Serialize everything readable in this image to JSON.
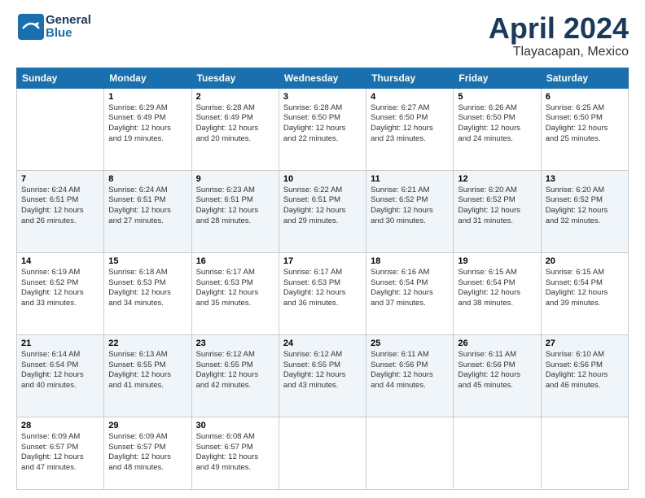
{
  "header": {
    "logo_line1": "General",
    "logo_line2": "Blue",
    "month": "April 2024",
    "location": "Tlayacapan, Mexico"
  },
  "columns": [
    "Sunday",
    "Monday",
    "Tuesday",
    "Wednesday",
    "Thursday",
    "Friday",
    "Saturday"
  ],
  "weeks": [
    [
      {
        "day": "",
        "info": ""
      },
      {
        "day": "1",
        "info": "Sunrise: 6:29 AM\nSunset: 6:49 PM\nDaylight: 12 hours\nand 19 minutes."
      },
      {
        "day": "2",
        "info": "Sunrise: 6:28 AM\nSunset: 6:49 PM\nDaylight: 12 hours\nand 20 minutes."
      },
      {
        "day": "3",
        "info": "Sunrise: 6:28 AM\nSunset: 6:50 PM\nDaylight: 12 hours\nand 22 minutes."
      },
      {
        "day": "4",
        "info": "Sunrise: 6:27 AM\nSunset: 6:50 PM\nDaylight: 12 hours\nand 23 minutes."
      },
      {
        "day": "5",
        "info": "Sunrise: 6:26 AM\nSunset: 6:50 PM\nDaylight: 12 hours\nand 24 minutes."
      },
      {
        "day": "6",
        "info": "Sunrise: 6:25 AM\nSunset: 6:50 PM\nDaylight: 12 hours\nand 25 minutes."
      }
    ],
    [
      {
        "day": "7",
        "info": "Sunrise: 6:24 AM\nSunset: 6:51 PM\nDaylight: 12 hours\nand 26 minutes."
      },
      {
        "day": "8",
        "info": "Sunrise: 6:24 AM\nSunset: 6:51 PM\nDaylight: 12 hours\nand 27 minutes."
      },
      {
        "day": "9",
        "info": "Sunrise: 6:23 AM\nSunset: 6:51 PM\nDaylight: 12 hours\nand 28 minutes."
      },
      {
        "day": "10",
        "info": "Sunrise: 6:22 AM\nSunset: 6:51 PM\nDaylight: 12 hours\nand 29 minutes."
      },
      {
        "day": "11",
        "info": "Sunrise: 6:21 AM\nSunset: 6:52 PM\nDaylight: 12 hours\nand 30 minutes."
      },
      {
        "day": "12",
        "info": "Sunrise: 6:20 AM\nSunset: 6:52 PM\nDaylight: 12 hours\nand 31 minutes."
      },
      {
        "day": "13",
        "info": "Sunrise: 6:20 AM\nSunset: 6:52 PM\nDaylight: 12 hours\nand 32 minutes."
      }
    ],
    [
      {
        "day": "14",
        "info": "Sunrise: 6:19 AM\nSunset: 6:52 PM\nDaylight: 12 hours\nand 33 minutes."
      },
      {
        "day": "15",
        "info": "Sunrise: 6:18 AM\nSunset: 6:53 PM\nDaylight: 12 hours\nand 34 minutes."
      },
      {
        "day": "16",
        "info": "Sunrise: 6:17 AM\nSunset: 6:53 PM\nDaylight: 12 hours\nand 35 minutes."
      },
      {
        "day": "17",
        "info": "Sunrise: 6:17 AM\nSunset: 6:53 PM\nDaylight: 12 hours\nand 36 minutes."
      },
      {
        "day": "18",
        "info": "Sunrise: 6:16 AM\nSunset: 6:54 PM\nDaylight: 12 hours\nand 37 minutes."
      },
      {
        "day": "19",
        "info": "Sunrise: 6:15 AM\nSunset: 6:54 PM\nDaylight: 12 hours\nand 38 minutes."
      },
      {
        "day": "20",
        "info": "Sunrise: 6:15 AM\nSunset: 6:54 PM\nDaylight: 12 hours\nand 39 minutes."
      }
    ],
    [
      {
        "day": "21",
        "info": "Sunrise: 6:14 AM\nSunset: 6:54 PM\nDaylight: 12 hours\nand 40 minutes."
      },
      {
        "day": "22",
        "info": "Sunrise: 6:13 AM\nSunset: 6:55 PM\nDaylight: 12 hours\nand 41 minutes."
      },
      {
        "day": "23",
        "info": "Sunrise: 6:12 AM\nSunset: 6:55 PM\nDaylight: 12 hours\nand 42 minutes."
      },
      {
        "day": "24",
        "info": "Sunrise: 6:12 AM\nSunset: 6:55 PM\nDaylight: 12 hours\nand 43 minutes."
      },
      {
        "day": "25",
        "info": "Sunrise: 6:11 AM\nSunset: 6:56 PM\nDaylight: 12 hours\nand 44 minutes."
      },
      {
        "day": "26",
        "info": "Sunrise: 6:11 AM\nSunset: 6:56 PM\nDaylight: 12 hours\nand 45 minutes."
      },
      {
        "day": "27",
        "info": "Sunrise: 6:10 AM\nSunset: 6:56 PM\nDaylight: 12 hours\nand 46 minutes."
      }
    ],
    [
      {
        "day": "28",
        "info": "Sunrise: 6:09 AM\nSunset: 6:57 PM\nDaylight: 12 hours\nand 47 minutes."
      },
      {
        "day": "29",
        "info": "Sunrise: 6:09 AM\nSunset: 6:57 PM\nDaylight: 12 hours\nand 48 minutes."
      },
      {
        "day": "30",
        "info": "Sunrise: 6:08 AM\nSunset: 6:57 PM\nDaylight: 12 hours\nand 49 minutes."
      },
      {
        "day": "",
        "info": ""
      },
      {
        "day": "",
        "info": ""
      },
      {
        "day": "",
        "info": ""
      },
      {
        "day": "",
        "info": ""
      }
    ]
  ]
}
